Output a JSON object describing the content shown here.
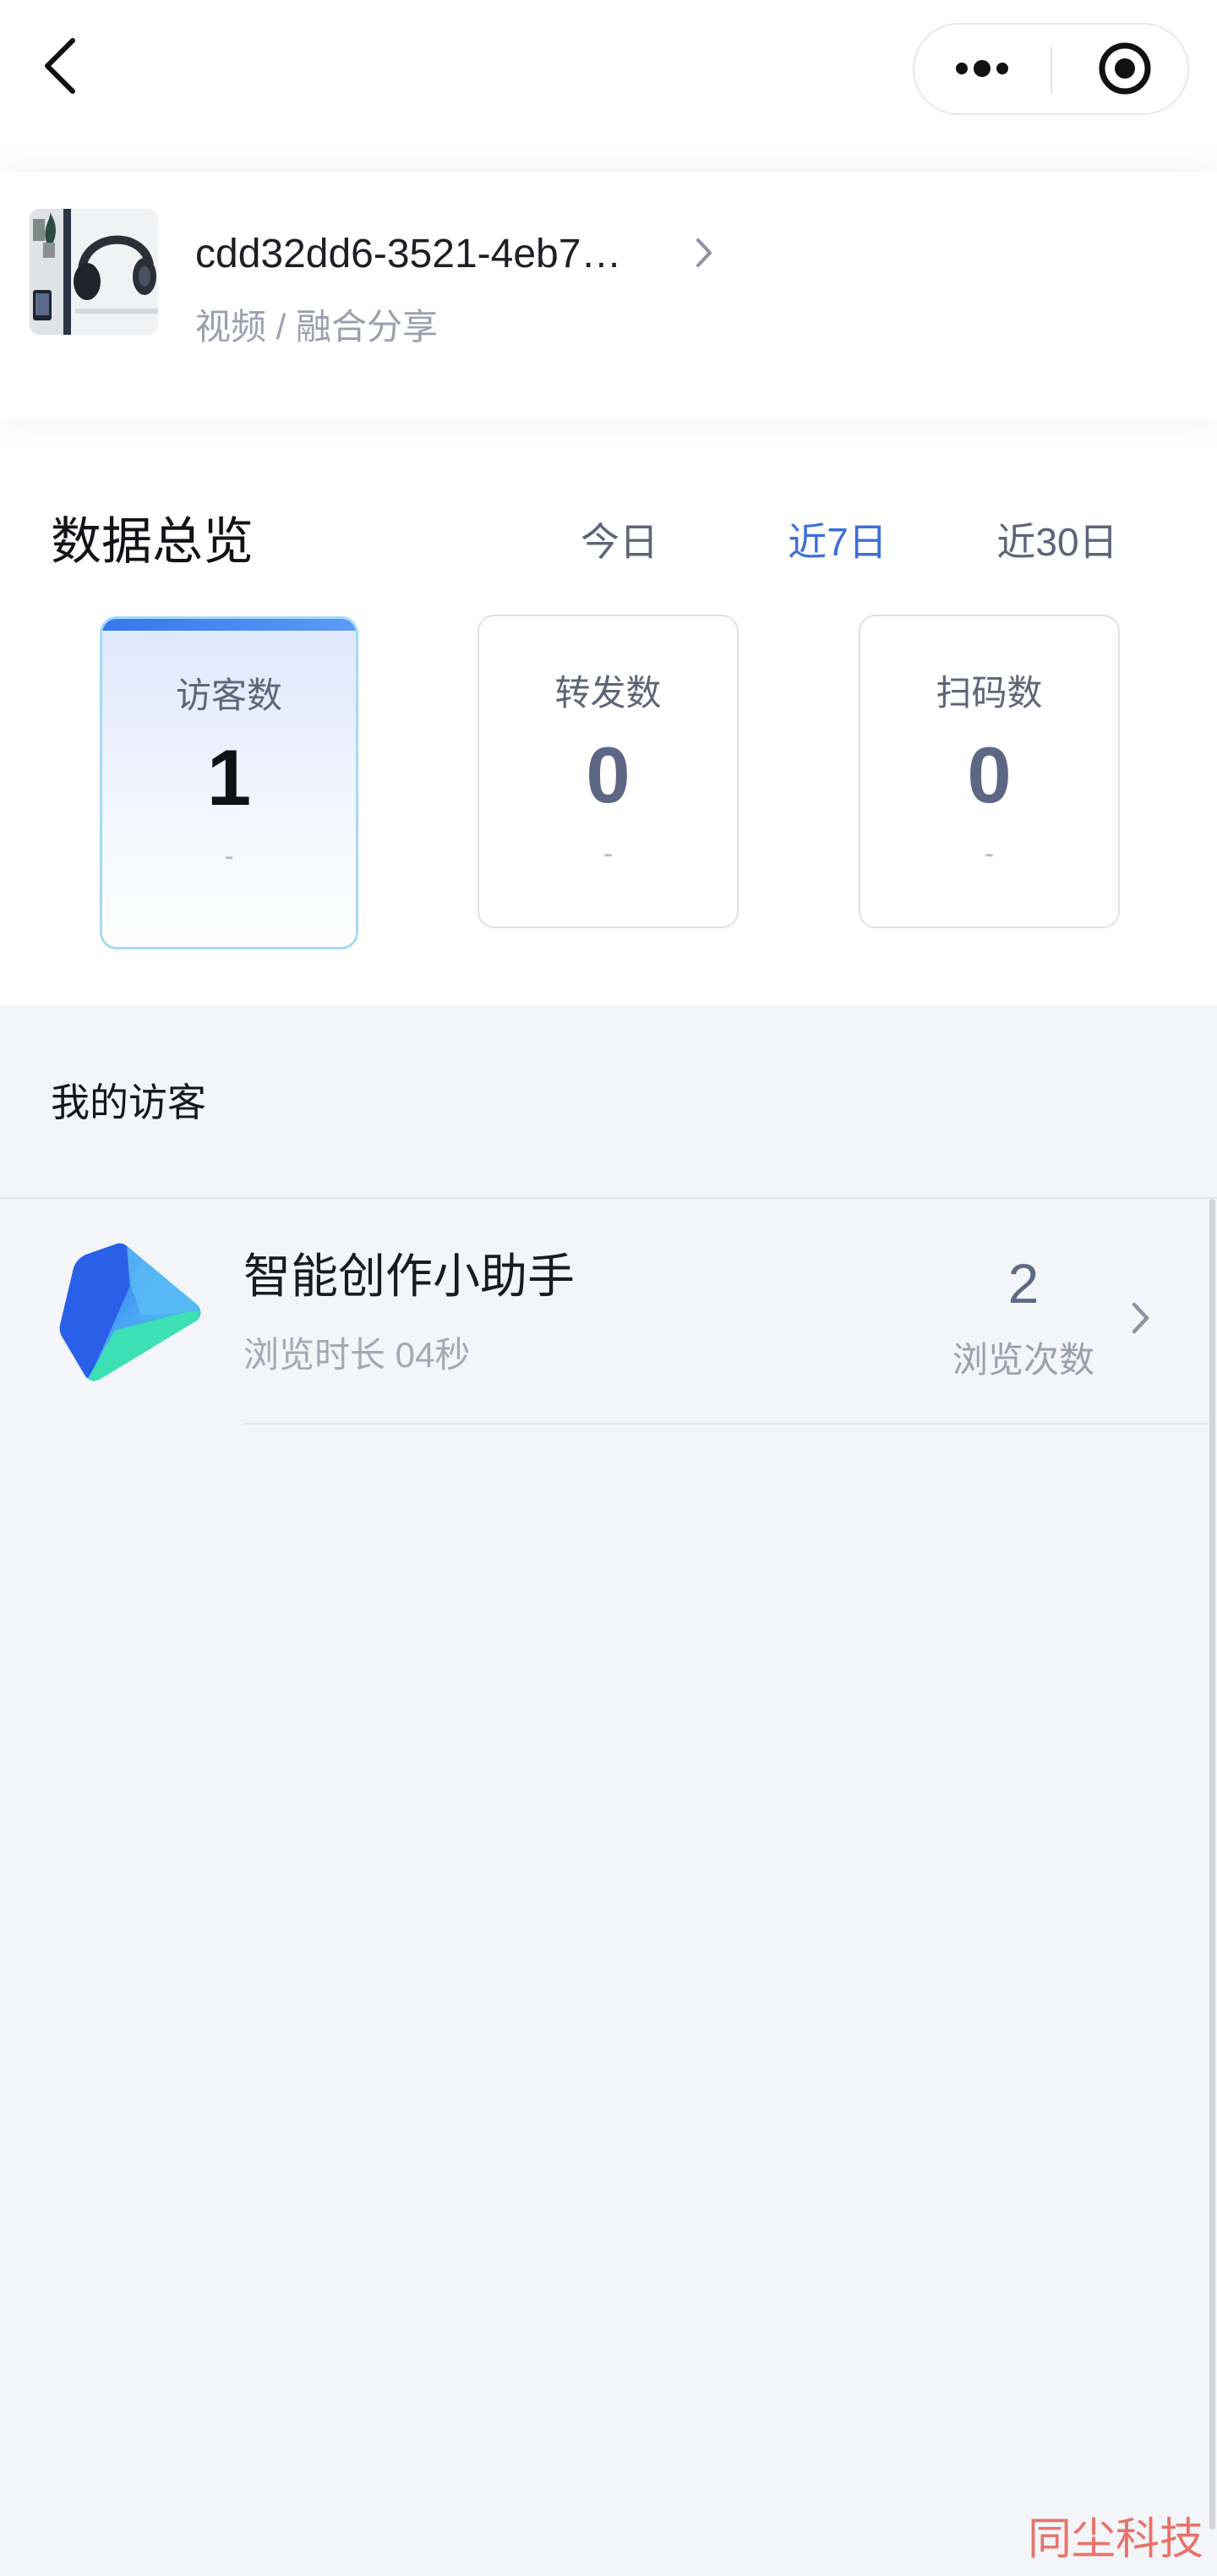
{
  "nav": {
    "back_icon": "chevron-left-icon",
    "more_icon": "more-dots-icon",
    "target_icon": "target-icon"
  },
  "content": {
    "title": "cdd32dd6-3521-4eb7…",
    "subtitle": "视频 / 融合分享",
    "thumbnail_icon": "video-thumbnail",
    "chevron_icon": "chevron-right-icon"
  },
  "overview": {
    "title": "数据总览",
    "tabs": [
      {
        "label": "今日",
        "active": false
      },
      {
        "label": "近7日",
        "active": true
      },
      {
        "label": "近30日",
        "active": false
      }
    ],
    "stats": [
      {
        "label": "访客数",
        "value": "1",
        "delta": "-",
        "selected": true
      },
      {
        "label": "转发数",
        "value": "0",
        "delta": "-",
        "selected": false
      },
      {
        "label": "扫码数",
        "value": "0",
        "delta": "-",
        "selected": false
      }
    ]
  },
  "visitors": {
    "title": "我的访客",
    "items": [
      {
        "name": "智能创作小助手",
        "duration": "浏览时长 04秒",
        "count": "2",
        "count_label": "浏览次数",
        "avatar_icon": "app-logo-icon"
      }
    ]
  },
  "watermark": "同尘科技",
  "colors": {
    "accent": "#3d6fd6",
    "background": "#f4f5f9",
    "text_primary": "#1a1b1f",
    "text_secondary": "#9aa0ad",
    "stat_value": "#5c6785",
    "watermark": "#e8736b"
  }
}
